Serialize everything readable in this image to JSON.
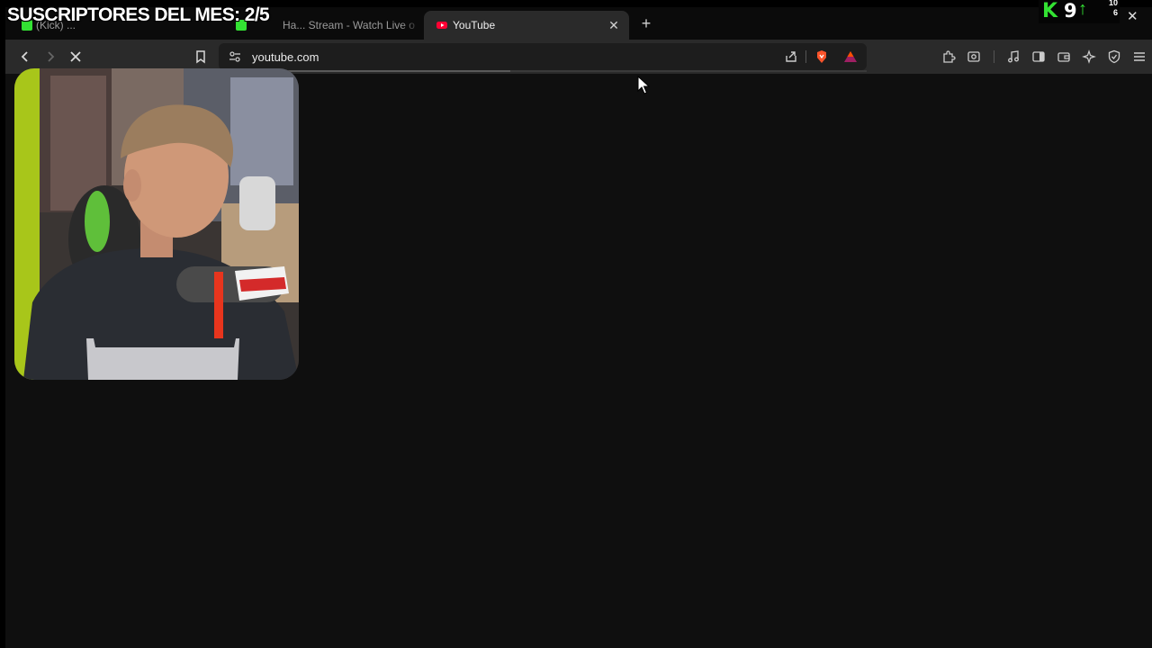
{
  "overlay": {
    "title": "SUSCRIPTORES DEL MES: 2/5"
  },
  "stats": {
    "kick_icon": "kick-logo-icon",
    "count": "9",
    "mini_top": "10",
    "mini_bottom": "6"
  },
  "tabs": [
    {
      "title": "(Kick) ...",
      "favicon": "kick-icon",
      "active": false
    },
    {
      "title": "Ha... Stream - Watch Live o",
      "favicon": "kick-icon",
      "active": false
    },
    {
      "title": "YouTube",
      "favicon": "youtube-icon",
      "active": true
    }
  ],
  "toolbar": {
    "url": "youtube.com",
    "load_progress": 0.45
  },
  "colors": {
    "kick_green": "#33e233",
    "youtube_red": "#ff0033",
    "brave_orange": "#fb542b"
  }
}
